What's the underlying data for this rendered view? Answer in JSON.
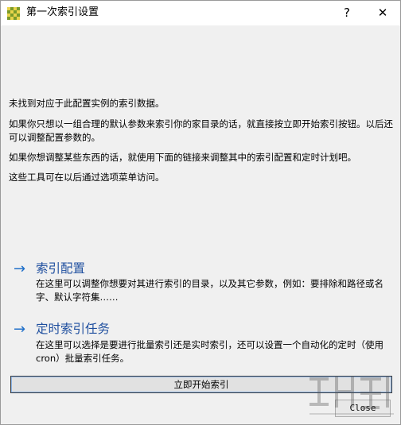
{
  "window": {
    "title": "第一次索引设置",
    "help": "?",
    "close": "✕"
  },
  "messages": [
    "未找到对应于此配置实例的索引数据。",
    "如果你只想以一组合理的默认参数来索引你的家目录的话，就直接按立即开始索引按钮。以后还可以调整配置参数的。",
    "如果你想调整某些东西的话，就使用下面的链接来调整其中的索引配置和定时计划吧。",
    "这些工具可在以后通过选项菜单访问。"
  ],
  "links": [
    {
      "arrow": "→",
      "title": "索引配置",
      "desc": "在这里可以调整你想要对其进行索引的目录，以及其它参数，例如：要排除和路径或名字、默认字符集……"
    },
    {
      "arrow": "→",
      "title": "定时索引任务",
      "desc": "在这里可以选择是要进行批量索引还是实时索引，还可以设置一个自动化的定时（使用cron）批量索引任务。"
    }
  ],
  "buttons": {
    "start": "立即开始索引",
    "close": "Close"
  },
  "icons": {
    "app": "checkerboard-app-icon",
    "link_arrow": "right-arrow-icon"
  },
  "colors": {
    "link": "#1f4f9f",
    "arrow": "#1f6fc9",
    "background": "#f0f0f0"
  }
}
